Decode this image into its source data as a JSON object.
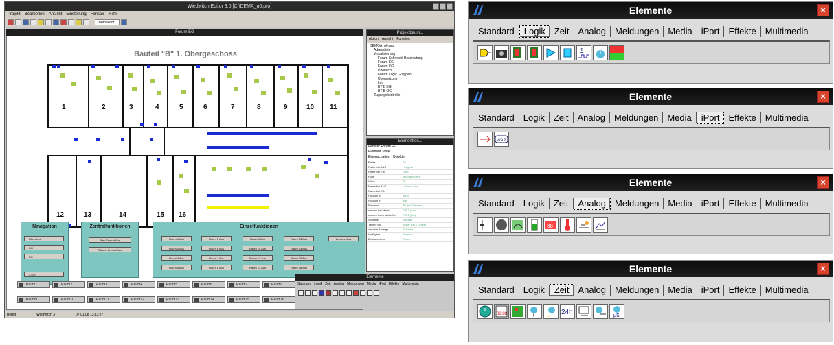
{
  "editor": {
    "title": "Wiedwitch Editor 3.0 [C:\\DEMA_n0.pro]",
    "menu": [
      "Projekt",
      "Bearbeiten",
      "Ansicht",
      "Einstellung",
      "Fenster",
      "Hilfe"
    ],
    "zoom": "Zoomfaktor",
    "form_title": "Forum EG",
    "plan_title": "Bauteil \"B\" 1. Obergeschoss",
    "room_numbers": [
      "1",
      "2",
      "3",
      "4",
      "5",
      "6",
      "7",
      "8",
      "9",
      "10",
      "11",
      "12",
      "13",
      "14",
      "15",
      "16"
    ],
    "panels": {
      "navigation": {
        "title": "Navigation",
        "buttons": [
          "Übersicht",
          "UG",
          "EG",
          "2.OG"
        ]
      },
      "zentral": {
        "title": "Zentralfunktionen",
        "buttons": [
          "Raw Zentral Aus",
          "Räume Zentral Aus"
        ]
      },
      "einzel": {
        "title": "Einzelfunktionen",
        "buttons": [
          "Raum 1 Aus",
          "Raum 5 Aus",
          "Raum 9 Aus",
          "Raum 13 Aus",
          "Raum 2 Aus",
          "Raum 6 Aus",
          "Raum 10 Aus",
          "Raum 14 Aus",
          "Raum 3 Aus",
          "Raum 7 Aus",
          "Raum 11 Aus",
          "Raum 15 Aus",
          "Raum 4 Aus",
          "Raum 8 Aus",
          "Raum 12 Aus",
          "Raum 16 Aus",
          "Lehrerz. Aus"
        ]
      }
    },
    "room_buttons": [
      "Raum1",
      "Raum2",
      "Raum3",
      "Raum4",
      "Raum5",
      "Raum6",
      "Raum7",
      "Raum8",
      "Raum9",
      "Raum10",
      "Raum11",
      "Raum12",
      "Raum13",
      "Raum14",
      "Raum15",
      "Raum16"
    ],
    "project": {
      "title": "Projektbaum...",
      "menu": [
        "Aktion",
        "Ansicht",
        "Funktion"
      ],
      "tree": [
        "DEMOA_n0.pro",
        "Adressliste",
        "Visualisierung",
        "Forum Schnecht Beschaltung",
        "Forum EG",
        "Forum OG",
        "Übersicht",
        "Forum Logik Gruppen",
        "Übersetzung",
        "Info",
        "BT B EG",
        "BT B OG",
        "Zugangskontrolle"
      ]
    },
    "elements": {
      "title": "Elementfen...",
      "meta": [
        "Fenster  Forum EG",
        "Element  Taste"
      ],
      "tabs": [
        "Eigenschaften",
        "Objekte"
      ],
      "props": [
        [
          "Breite",
          "70"
        ],
        [
          "Farbe bei AUS",
          "Hellgrau"
        ],
        [
          "Farbe bei EIN",
          "Gelb"
        ],
        [
          "Font",
          "MS Sans Serif"
        ],
        [
          "Höhe",
          "20"
        ],
        [
          "Name bei AUS",
          "Lehrerz. Aus"
        ],
        [
          "Name bei EIN",
          ""
        ],
        [
          "Position X",
          "1000"
        ],
        [
          "Position Y",
          "508"
        ],
        [
          "Rahmen",
          "3D auf Rahmen"
        ],
        [
          "senden bei öffnen",
          "EIS 1 (Aus)"
        ],
        [
          "senden beim schließen",
          "EIS 1 (Ein)"
        ],
        [
          "Schriftart",
          "Normal"
        ],
        [
          "Taster Typ",
          "Taster Ein 1 Objekt"
        ],
        [
          "variable Anzeige",
          "Schwarz"
        ],
        [
          "Verfügbar",
          "Ebene 0"
        ],
        [
          "Zeichenebene",
          "Ebene"
        ]
      ]
    },
    "mini_elements": {
      "title": "Elemente",
      "tabs": [
        "Standard",
        "Logik",
        "Zeit",
        "Analog",
        "Meldungen",
        "Media",
        "iPort",
        "Effekte",
        "Multimedia"
      ]
    },
    "status": [
      "Bereit",
      "Wiedwitch 3",
      "07.01.08 13:13:27"
    ]
  },
  "palettes": [
    {
      "title": "Elemente",
      "active": "Logik",
      "tabs": [
        "Standard",
        "Logik",
        "Zeit",
        "Analog",
        "Meldungen",
        "Media",
        "iPort",
        "Effekte",
        "Multimedia"
      ],
      "icons": [
        "gate-icon",
        "camera-icon",
        "film-1-icon",
        "film-8-icon",
        "and-gate-icon",
        "flipflop-icon",
        "sum-pulse-icon",
        "timer-icon",
        "red-green-icon"
      ]
    },
    {
      "title": "Elemente",
      "active": "iPort",
      "tabs": [
        "Standard",
        "Logik",
        "Zeit",
        "Analog",
        "Meldungen",
        "Media",
        "iPort",
        "Effekte",
        "Multimedia"
      ],
      "icons": [
        "iport-arrows-icon",
        "wap-icon"
      ]
    },
    {
      "title": "Elemente",
      "active": "Analog",
      "tabs": [
        "Standard",
        "Logik",
        "Zeit",
        "Analog",
        "Meldungen",
        "Media",
        "iPort",
        "Effekte",
        "Multimedia"
      ],
      "icons": [
        "analog-slider-icon",
        "circle-icon",
        "analog-meter-icon",
        "level-bar-icon",
        "digit-display-icon",
        "thermometer-icon",
        "value-input-icon",
        "graph-icon"
      ]
    },
    {
      "title": "Elemente",
      "active": "Zeit",
      "tabs": [
        "Standard",
        "Logik",
        "Zeit",
        "Analog",
        "Meldungen",
        "Media",
        "iPort",
        "Effekte",
        "Multimedia"
      ],
      "icons": [
        "clock-icon",
        "calendar-clock-icon",
        "weekly-grid-icon",
        "timer-switch-icon",
        "timer-switch2-icon",
        "24h-icon",
        "date-timer-icon",
        "cycle-icon",
        "cycle-us-icon"
      ]
    }
  ]
}
